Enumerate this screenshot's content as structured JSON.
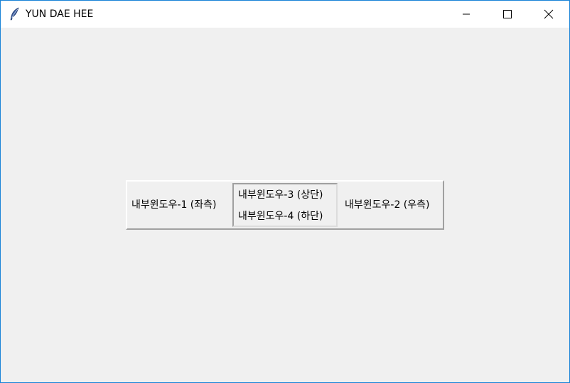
{
  "window": {
    "title": "YUN DAE HEE",
    "controls": {
      "minimize": "minimize",
      "maximize": "maximize",
      "close": "close"
    }
  },
  "panes": {
    "left": "내부윈도우-1 (좌측)",
    "right": "내부윈도우-2 (우측)",
    "top": "내부윈도우-3 (상단)",
    "bottom": "내부윈도우-4 (하단)"
  }
}
